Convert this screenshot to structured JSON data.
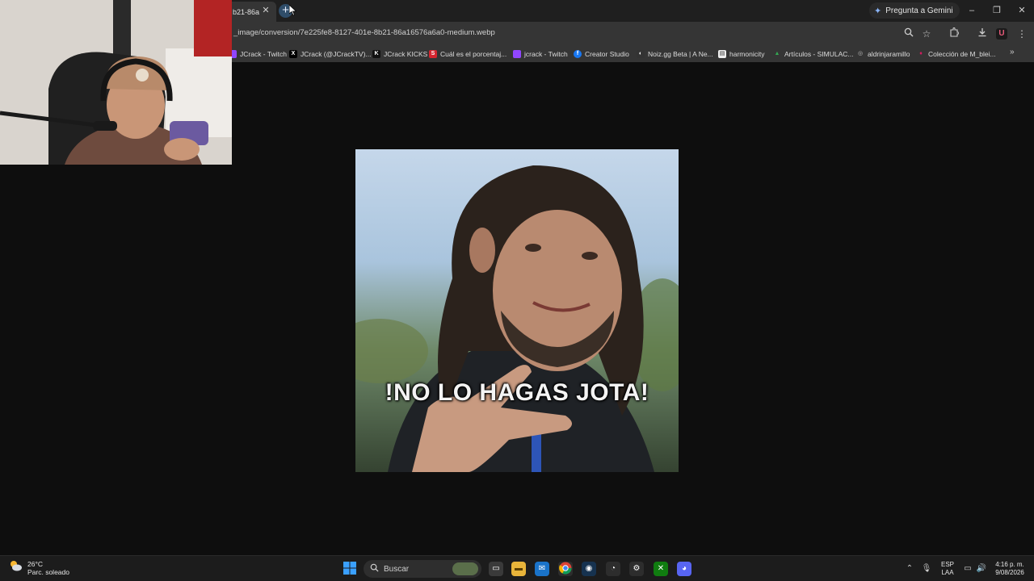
{
  "browser": {
    "active_tab_title": "b21-86a",
    "tab_close_glyph": "✕",
    "new_tab_glyph": "+",
    "gemini_button_label": "Pregunta a Gemini",
    "address": "_image/conversion/7e225fe8-8127-401e-8b21-86a16576a6a0-medium.webp",
    "window_controls": [
      "–",
      "❐",
      "✕"
    ],
    "toolbar_icons": [
      "zoom-icon",
      "bookmark-star-icon",
      "extensions-icon",
      "download-icon",
      "profile-extension-icon",
      "menu-icon"
    ],
    "extension_badge": "U",
    "bookmarks": [
      {
        "label": "JCrack - Twitch",
        "icon": "twitch-icon",
        "color": "#9146ff",
        "glyph": ""
      },
      {
        "label": "JCrack (@JCrackTV)...",
        "icon": "x-icon",
        "color": "#000000",
        "glyph": "X"
      },
      {
        "label": "JCrack KICKS",
        "icon": "kick-icon",
        "color": "#111111",
        "glyph": "K"
      },
      {
        "label": "Cuál es el porcentaj...",
        "icon": "s-site-icon",
        "color": "#d6252f",
        "glyph": "S"
      },
      {
        "label": "jcrack - Twitch",
        "icon": "twitch-icon",
        "color": "#9146ff",
        "glyph": ""
      },
      {
        "label": "Creator Studio",
        "icon": "facebook-icon",
        "color": "#1877f2",
        "glyph": "f"
      },
      {
        "label": "Noiz.gg Beta | A Ne...",
        "icon": "noiz-icon",
        "color": "#333333",
        "glyph": "◐"
      },
      {
        "label": "harmonicity",
        "icon": "harmonicity-icon",
        "color": "#eeeeee",
        "glyph": "▤"
      },
      {
        "label": "Artículos - SIMULAC...",
        "icon": "drive-icon",
        "color": "#34a853",
        "glyph": "▲"
      },
      {
        "label": "aldrinjaramillo",
        "icon": "globe-icon",
        "color": "#5f6368",
        "glyph": "◎"
      },
      {
        "label": "Colección de M_blei...",
        "icon": "collection-icon",
        "color": "#d81b60",
        "glyph": "♦"
      }
    ],
    "bookmarks_overflow": "»"
  },
  "meme": {
    "caption": "!NO LO HAGAS JOTA!"
  },
  "taskbar": {
    "weather_temp": "26°C",
    "weather_desc": "Parc. soleado",
    "search_label": "Buscar",
    "lang_top": "ESP",
    "lang_bottom": "LAA",
    "time": "4:16 p. m.",
    "date": "9/08/2026"
  },
  "colors": {
    "tabstrip": "#1f1f1f",
    "toolbar": "#353535",
    "page_bg": "#0e0e0e",
    "taskbar": "#1c1c1c",
    "accent_blue": "#8ab4f8"
  }
}
